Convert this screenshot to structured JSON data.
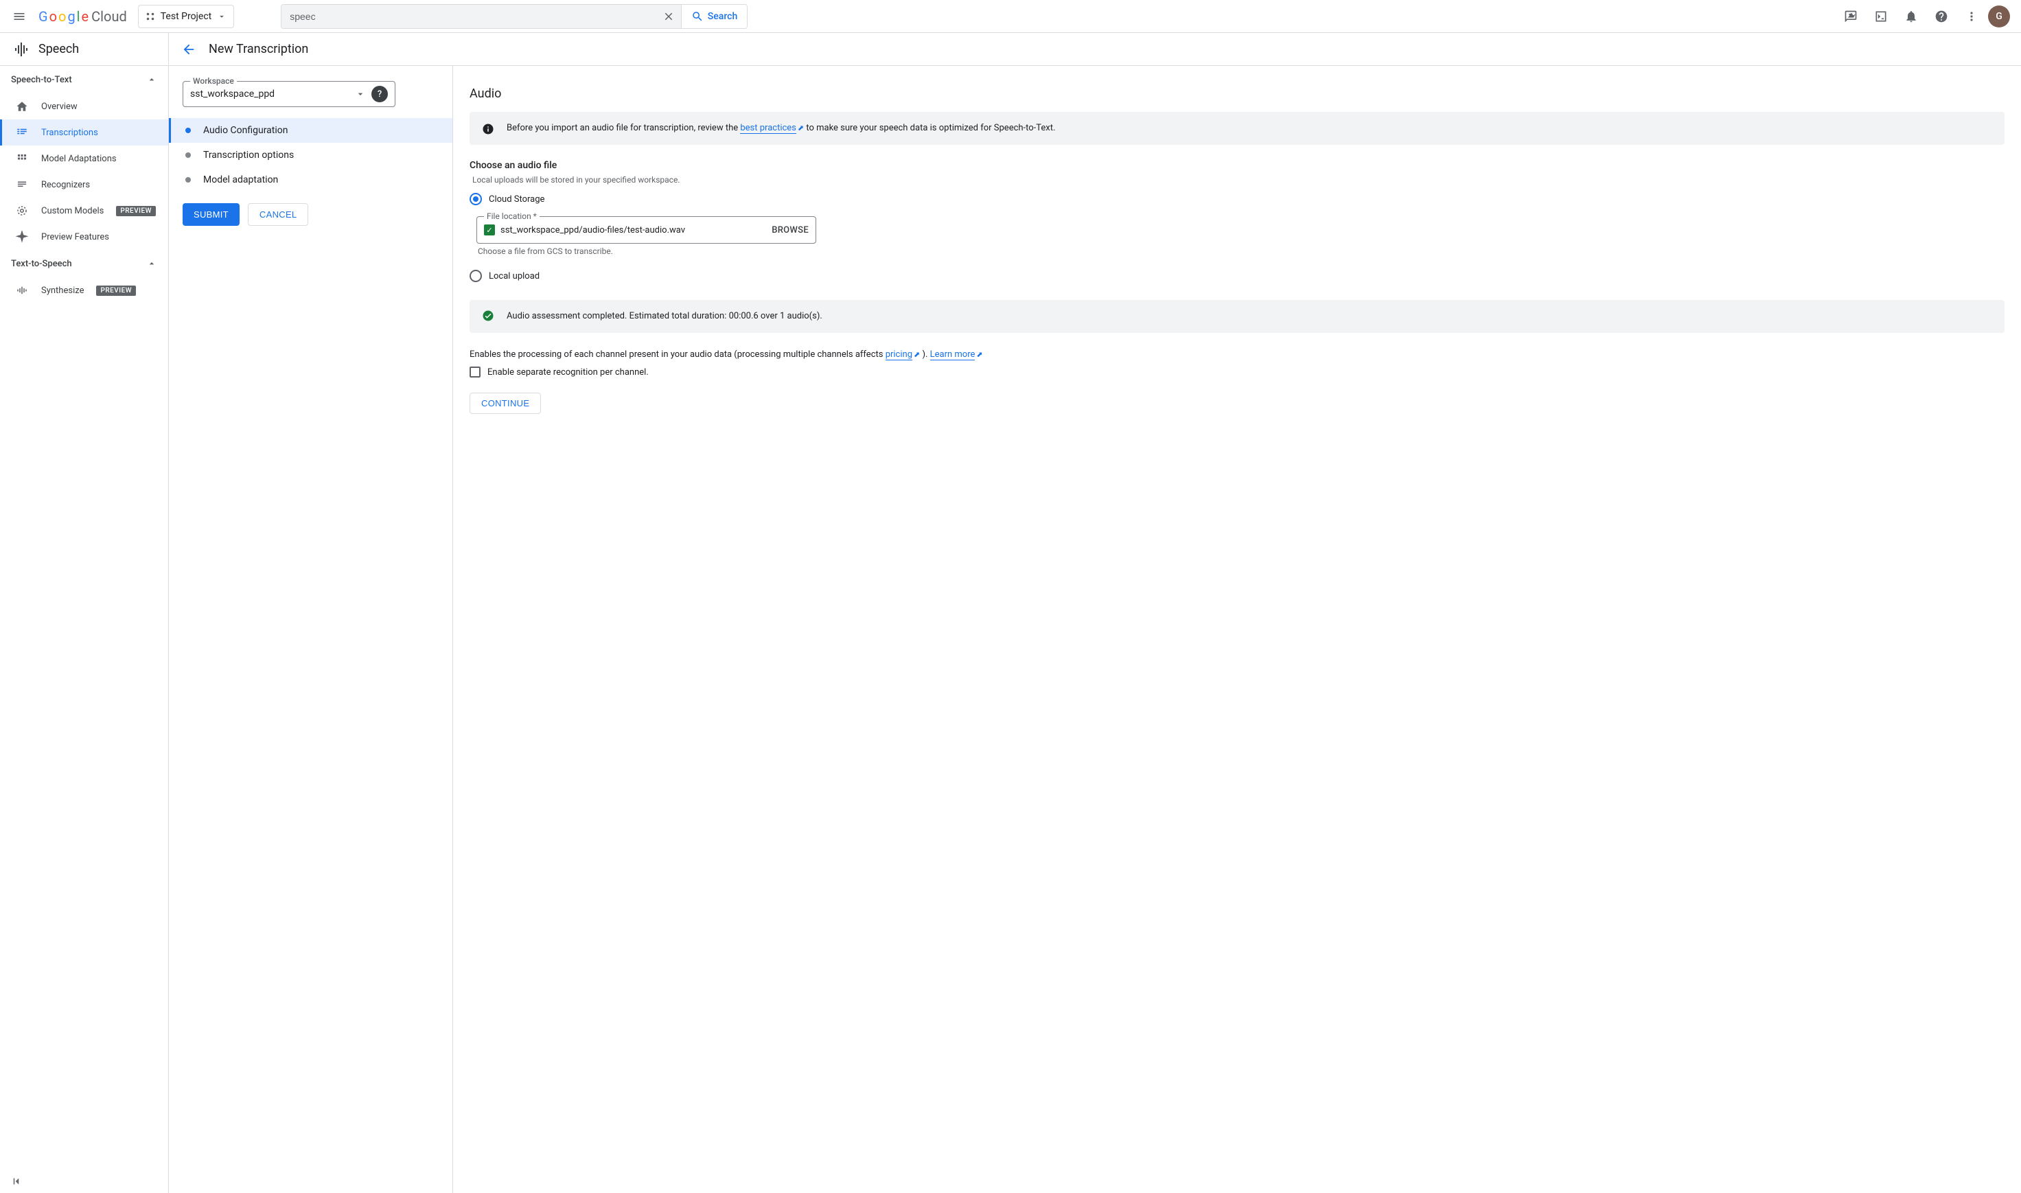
{
  "header": {
    "logo_text": "Google",
    "logo_suffix": "Cloud",
    "project": "Test Project",
    "search_value": "speec",
    "search_button": "Search",
    "avatar_letter": "G"
  },
  "sidebar": {
    "product": "Speech",
    "section_stt": "Speech-to-Text",
    "items_stt": [
      {
        "label": "Overview"
      },
      {
        "label": "Transcriptions"
      },
      {
        "label": "Model Adaptations"
      },
      {
        "label": "Recognizers"
      },
      {
        "label": "Custom Models",
        "badge": "PREVIEW"
      },
      {
        "label": "Preview Features"
      }
    ],
    "section_tts": "Text-to-Speech",
    "items_tts": [
      {
        "label": "Synthesize",
        "badge": "PREVIEW"
      }
    ]
  },
  "middle": {
    "title": "New Transcription",
    "workspace_label": "Workspace",
    "workspace_value": "sst_workspace_ppd",
    "steps": [
      "Audio Configuration",
      "Transcription options",
      "Model adaptation"
    ],
    "submit": "SUBMIT",
    "cancel": "CANCEL"
  },
  "content": {
    "heading": "Audio",
    "info_pre": "Before you import an audio file for transcription, review the ",
    "info_link": "best practices",
    "info_post": " to make sure your speech data is optimized for Speech-to-Text.",
    "choose_h": "Choose an audio file",
    "choose_hint": "Local uploads will be stored in your specified workspace.",
    "radio_cloud": "Cloud Storage",
    "radio_local": "Local upload",
    "file_label": "File location *",
    "file_value": "sst_workspace_ppd/audio-files/test-audio.wav",
    "browse": "BROWSE",
    "file_helper": "Choose a file from GCS to transcribe.",
    "assess": "Audio assessment completed. Estimated total duration: 00:00.6 over 1 audio(s).",
    "channel_pre": "Enables the processing of each channel present in your audio data (processing multiple channels affects ",
    "pricing": "pricing",
    "channel_mid": " ). ",
    "learn_more": "Learn more",
    "channel_chk": "Enable separate recognition per channel.",
    "continue": "CONTINUE"
  }
}
